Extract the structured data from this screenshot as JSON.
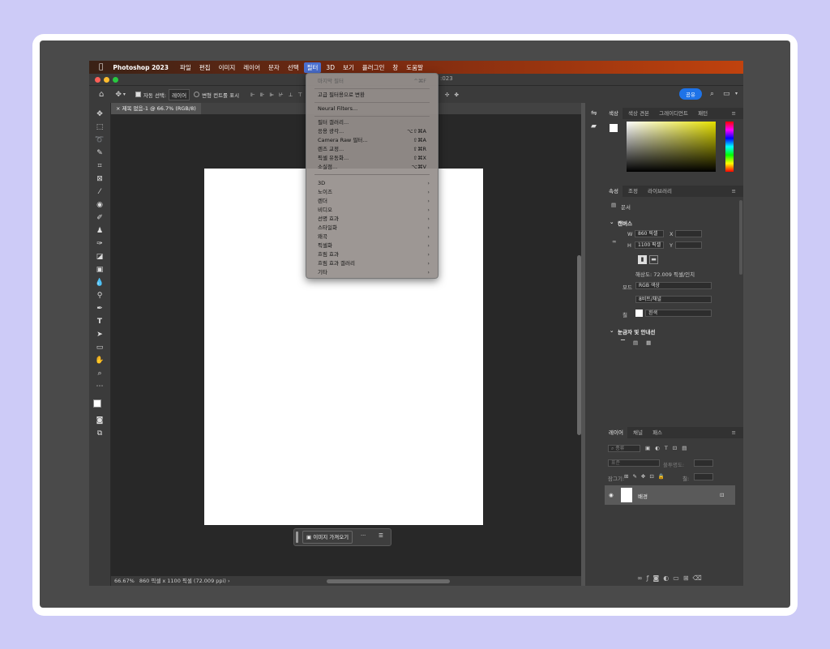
{
  "menubar": {
    "app_name": "Photoshop 2023",
    "items": [
      "파일",
      "편집",
      "이미지",
      "레이어",
      "문자",
      "선택",
      "필터",
      "3D",
      "보기",
      "플러그인",
      "창",
      "도움말"
    ],
    "active": "필터"
  },
  "title_fragment": ":023",
  "options_bar": {
    "auto_select_label": "자동 선택:",
    "auto_select_value": "레이어",
    "transform_label": "변형 컨트롤 표시",
    "share_label": "공유"
  },
  "document": {
    "tab_title": "제목 없음-1 @ 66.7% (RGB/8)",
    "zoom": "66.67%",
    "info": "860 픽셀 x 1100 픽셀 (72.009 ppi)"
  },
  "floating_bar": {
    "import_label": "이미지 가져오기",
    "more_label": "···"
  },
  "filter_menu": {
    "last_filter": {
      "label": "마지막 필터",
      "shortcut": "^⌘F"
    },
    "smart_filter": "고급 필터용으로 변환",
    "neural": "Neural Filters...",
    "group1": [
      {
        "label": "필터 갤러리...",
        "shortcut": ""
      },
      {
        "label": "응용 광각...",
        "shortcut": "⌥⇧⌘A"
      },
      {
        "label": "Camera Raw 필터...",
        "shortcut": "⇧⌘A"
      },
      {
        "label": "렌즈 교정...",
        "shortcut": "⇧⌘R"
      },
      {
        "label": "픽셀 유동화...",
        "shortcut": "⇧⌘X"
      },
      {
        "label": "소실점...",
        "shortcut": "⌥⌘V"
      }
    ],
    "submenus": [
      "3D",
      "노이즈",
      "렌더",
      "비디오",
      "선명 효과",
      "스타일화",
      "왜곡",
      "픽셀화",
      "흐림 효과",
      "흐림 효과 갤러리",
      "기타"
    ]
  },
  "color_panel": {
    "tabs": [
      "색상",
      "색상 견본",
      "그레이디언트",
      "패턴"
    ]
  },
  "properties_panel": {
    "tabs": [
      "속성",
      "조정",
      "라이브러리"
    ],
    "doc_label": "문서",
    "canvas_heading": "캔버스",
    "w_label": "W",
    "w_value": "860 픽셀",
    "h_label": "H",
    "h_value": "1100 픽셀",
    "x_label": "X",
    "y_label": "Y",
    "resolution": "해상도: 72.009 픽셀/인치",
    "mode_label": "모드",
    "mode_value": "RGB 색상",
    "depth_value": "8비트/채널",
    "fill_label": "칠",
    "fill_value": "흰색",
    "rulers_heading": "눈금자 및 안내선"
  },
  "layers_panel": {
    "tabs": [
      "레이어",
      "채널",
      "패스"
    ],
    "search_placeholder": "종류",
    "blend_mode": "표준",
    "opacity_label": "불투명도:",
    "lock_label": "잠그기:",
    "fill_label": "칠:",
    "layer_name": "배경"
  }
}
